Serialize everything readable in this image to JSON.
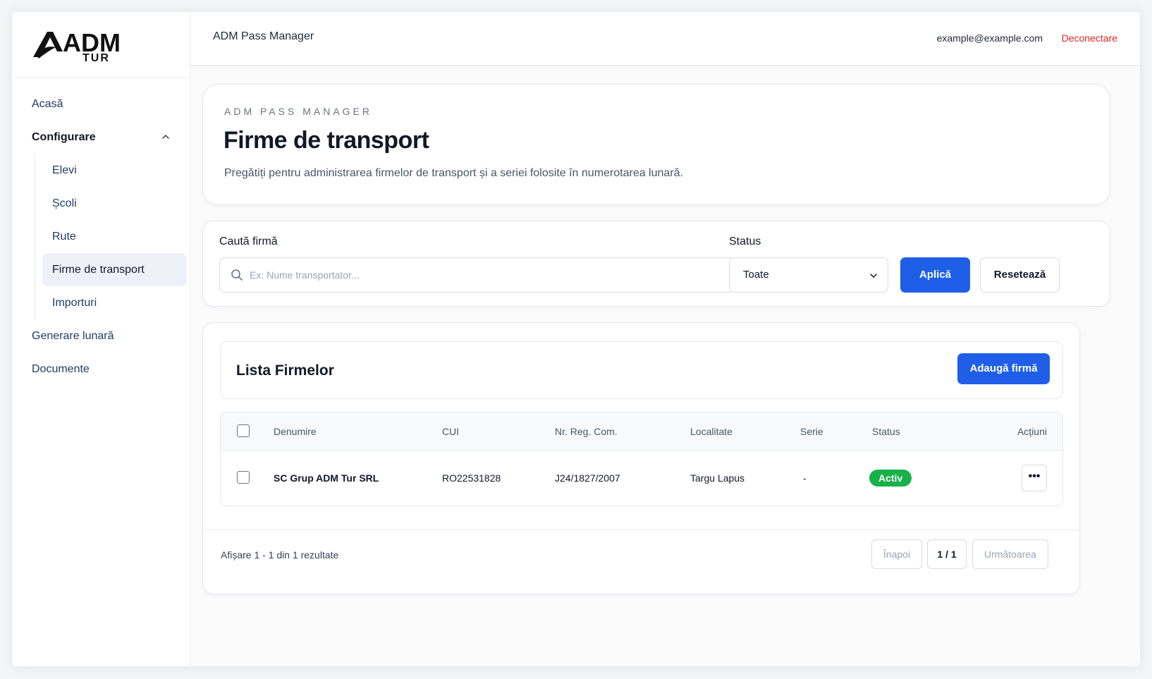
{
  "brand": {
    "logo_text_main": "ADM",
    "logo_text_sub": "TUR"
  },
  "sidebar": {
    "items": [
      {
        "label": "Acasă"
      },
      {
        "label": "Configurare",
        "expanded": true,
        "children": [
          {
            "label": "Elevi"
          },
          {
            "label": "Școli"
          },
          {
            "label": "Rute"
          },
          {
            "label": "Firme de transport",
            "active": true
          },
          {
            "label": "Importuri"
          }
        ]
      },
      {
        "label": "Generare lunară"
      },
      {
        "label": "Documente"
      }
    ]
  },
  "topbar": {
    "app_title": "ADM Pass Manager",
    "user_email": "example@example.com",
    "logout_label": "Deconectare"
  },
  "hero": {
    "eyebrow": "ADM PASS MANAGER",
    "title": "Firme de transport",
    "description": "Pregătiți pentru administrarea firmelor de transport și a seriei folosite în numerotarea lunară."
  },
  "filters": {
    "search_label": "Caută firmă",
    "search_placeholder": "Ex: Nume transportator...",
    "search_value": "",
    "status_label": "Status",
    "status_value": "Toate",
    "apply_label": "Aplică",
    "reset_label": "Resetează"
  },
  "list": {
    "title": "Lista Firmelor",
    "add_label": "Adaugă firmă",
    "columns": [
      "Denumire",
      "CUI",
      "Nr. Reg. Com.",
      "Localitate",
      "Serie",
      "Status",
      "Acțiuni"
    ],
    "rows": [
      {
        "denumire": "SC Grup ADM Tur SRL",
        "cui": "RO22531828",
        "nr_reg_com": "J24/1827/2007",
        "localitate": "Targu Lapus",
        "serie": "-",
        "status": "Activ"
      }
    ]
  },
  "pagination": {
    "summary": "Afișare 1 - 1 din 1 rezultate",
    "prev_label": "Înapoi",
    "current": "1 / 1",
    "next_label": "Următoarea"
  },
  "colors": {
    "primary": "#1f5fe8",
    "danger": "#dc2626",
    "success": "#18b14a"
  }
}
